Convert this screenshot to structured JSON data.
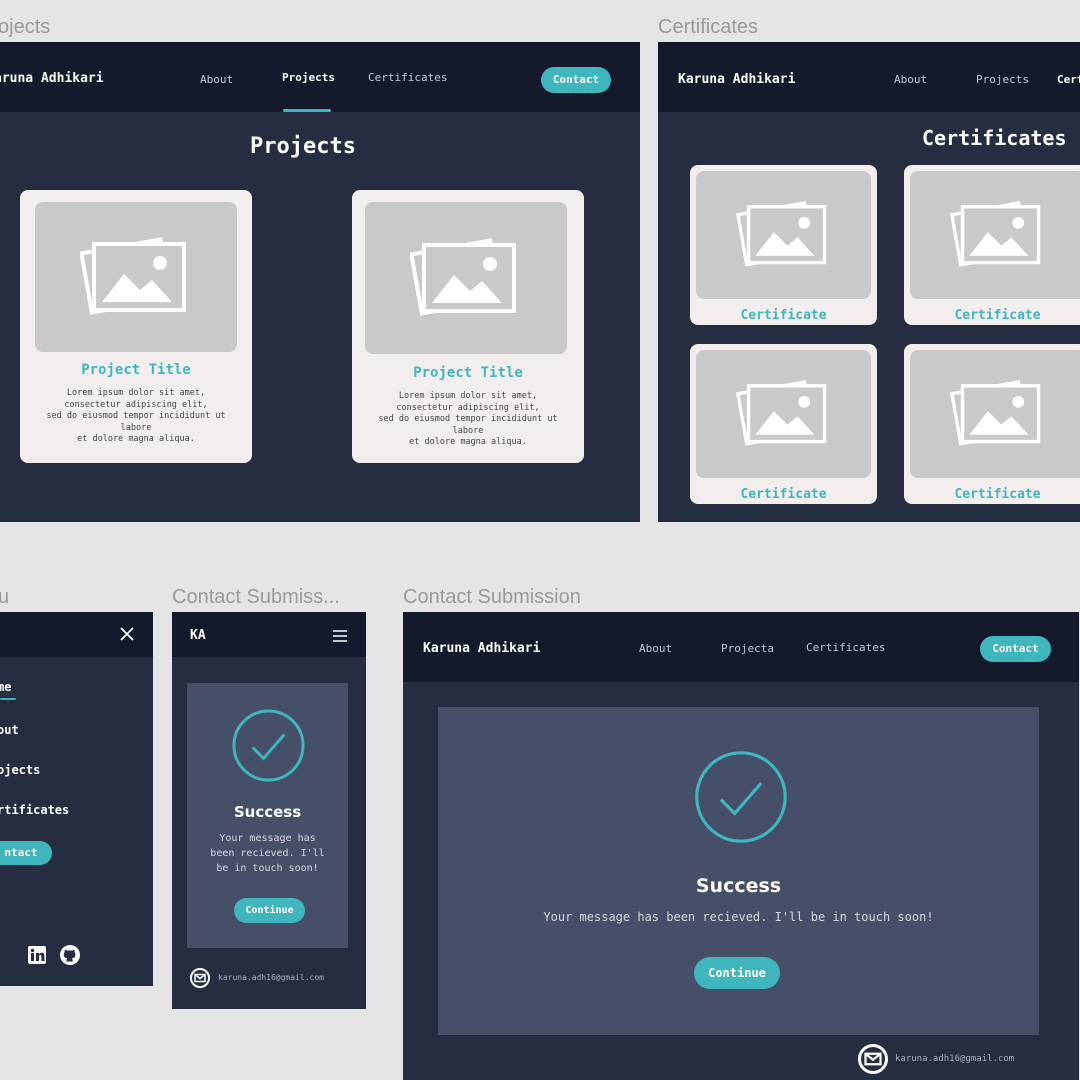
{
  "labels": {
    "projects_frame": "ojects",
    "certificates_frame": "Certificates",
    "menu_frame": "u",
    "contact_mobile_frame": "Contact Submiss...",
    "contact_desktop_frame": "Contact Submission"
  },
  "nav": {
    "brand": "Karuna Adhikari",
    "brand_cut": "aruna Adhikari",
    "brand_short": "KA",
    "about": "About",
    "projects": "Projects",
    "projects_alt": "Projecta",
    "certificates": "Certificates",
    "certificates_cut": "Cert",
    "contact": "Contact"
  },
  "projects_page": {
    "heading": "Projects",
    "cards": [
      {
        "title": "Project Title",
        "body": "Lorem ipsum dolor sit amet,\nconsectetur adipiscing elit,\nsed do eiusmod tempor incididunt ut\nlabore\net dolore magna aliqua."
      },
      {
        "title": "Project Title",
        "body": "Lorem ipsum dolor sit amet,\nconsectetur adipiscing elit,\nsed do eiusmod tempor incididunt ut\nlabore\net dolore magna aliqua."
      }
    ]
  },
  "certificates_page": {
    "heading": "Certificates",
    "cards": [
      "Certificate",
      "Certificate",
      "Certificate",
      "Certificate"
    ]
  },
  "mobile_menu": {
    "items": [
      "me",
      "out",
      "ojects",
      "rtificates"
    ],
    "contact": "ntact",
    "close_icon": "close-icon",
    "social_icons": [
      "linkedin-icon",
      "github-icon"
    ]
  },
  "contact_success": {
    "title": "Success",
    "message": "Your message has been recieved. I'll be in touch soon!",
    "message_mobile": "Your message has\nbeen recieved. I'll\nbe in touch soon!",
    "button": "Continue",
    "email": "karuna.adh16@gmail.com"
  },
  "colors": {
    "page_bg": "#e5e5e5",
    "frame_bg": "#262d41",
    "nav_bg": "#141a2b",
    "accent": "#3fb5bd",
    "card_bg": "#f3eeee",
    "panel_bg": "#454f67"
  }
}
